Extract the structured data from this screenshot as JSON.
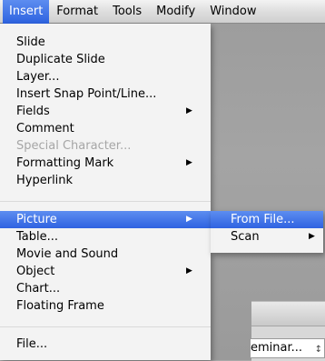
{
  "menubar": {
    "items": [
      "Insert",
      "Format",
      "Tools",
      "Modify",
      "Window"
    ]
  },
  "menu": {
    "items": [
      {
        "label": "Slide"
      },
      {
        "label": "Duplicate Slide"
      },
      {
        "label": "Layer..."
      },
      {
        "label": "Insert Snap Point/Line..."
      },
      {
        "label": "Fields",
        "submenu": true
      },
      {
        "label": "Comment"
      },
      {
        "label": "Special Character...",
        "disabled": true
      },
      {
        "label": "Formatting Mark",
        "submenu": true
      },
      {
        "label": "Hyperlink"
      },
      {
        "label": "Picture",
        "submenu": true,
        "highlighted": true
      },
      {
        "label": "Table..."
      },
      {
        "label": "Movie and Sound"
      },
      {
        "label": "Object",
        "submenu": true
      },
      {
        "label": "Chart..."
      },
      {
        "label": "Floating Frame"
      },
      {
        "label": "File..."
      }
    ]
  },
  "submenu": {
    "items": [
      {
        "label": "From File...",
        "highlighted": true
      },
      {
        "label": "Scan",
        "submenu": true
      }
    ]
  },
  "background_window": {
    "field_text": "eminar...",
    "stepper": "↕"
  },
  "icons": {
    "submenu_arrow": "▶"
  },
  "colors": {
    "highlight": "#2f63e1",
    "menu_bg": "#f6f6f6"
  }
}
